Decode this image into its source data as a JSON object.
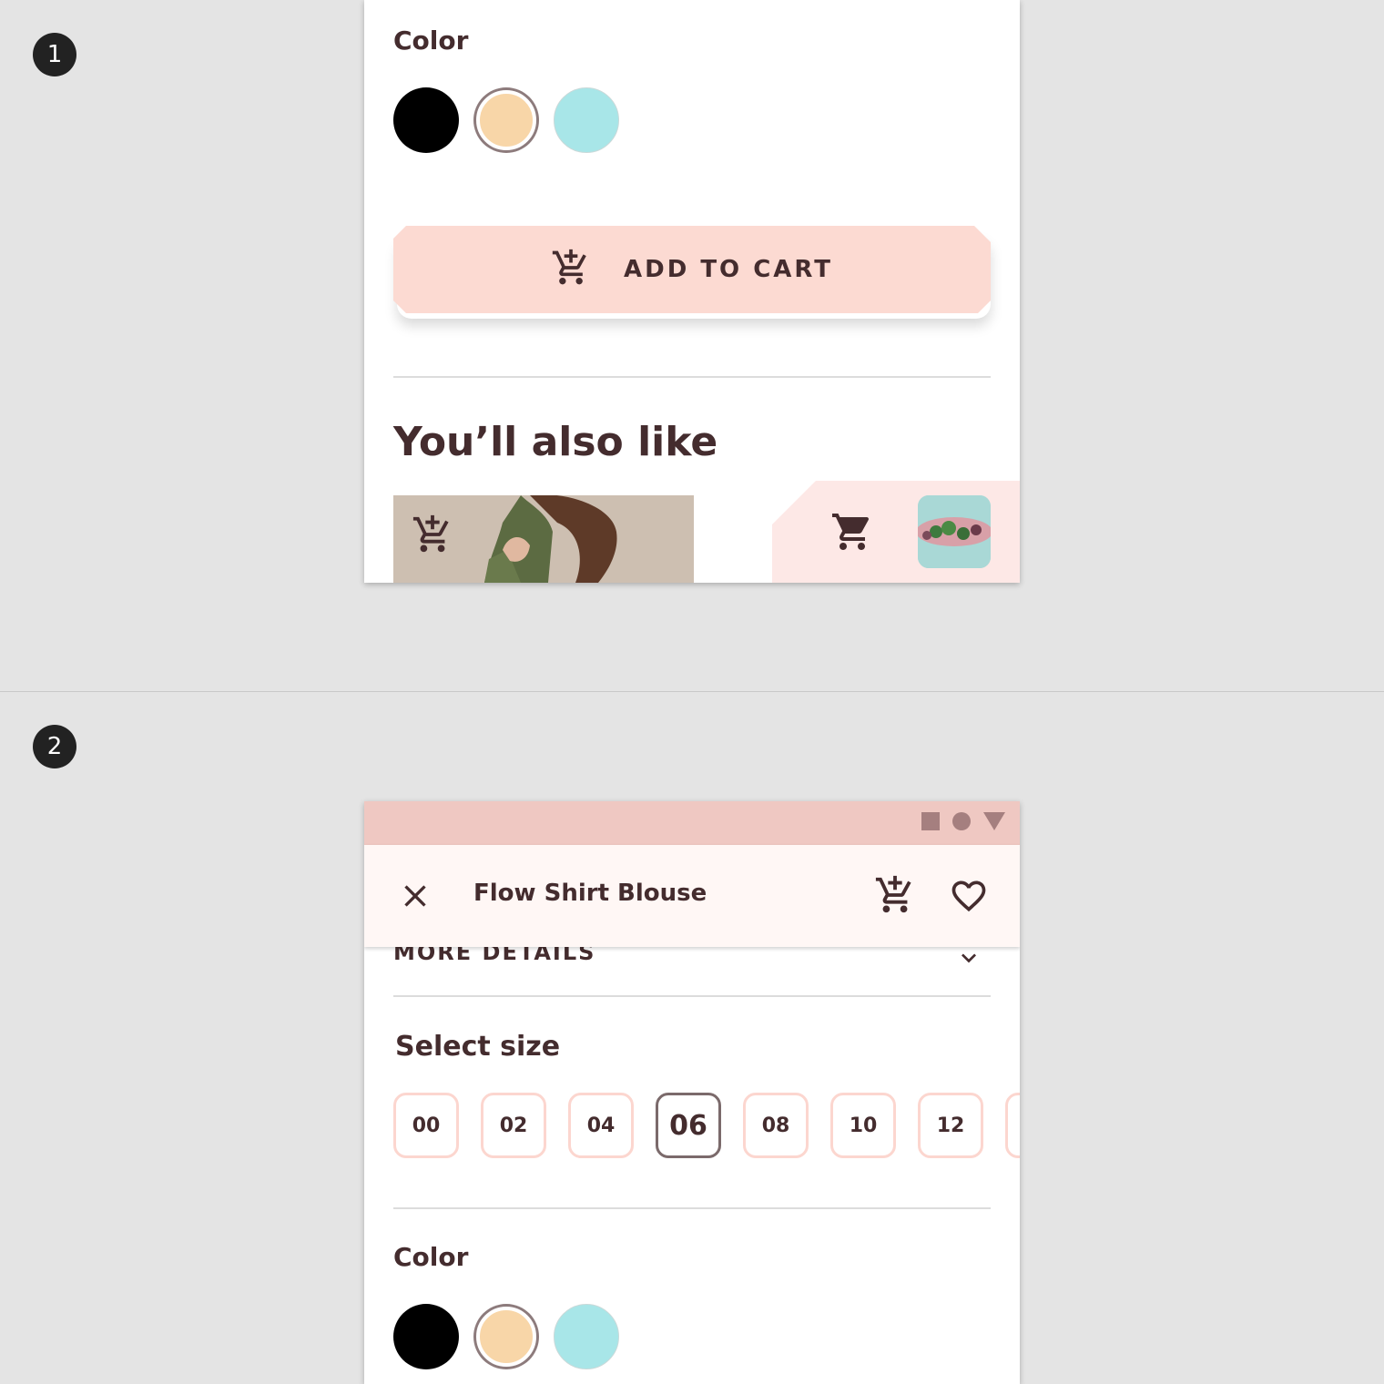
{
  "steps": [
    "1",
    "2"
  ],
  "screen1": {
    "color_label": "Color",
    "colors": [
      "#000000",
      "#f8d6a8",
      "#a8e6e8"
    ],
    "selected_color_index": 1,
    "add_to_cart_label": "ADD TO CART",
    "also_like_title": "You’ll also like"
  },
  "screen2": {
    "status_icons": [
      "square-icon",
      "circle-icon",
      "triangle-icon"
    ],
    "app_bar": {
      "title": "Flow Shirt Blouse",
      "close_icon": "close-icon",
      "cart_icon": "add-shopping-cart-icon",
      "favorite_icon": "heart-outline-icon"
    },
    "more_details_label": "MORE DETAILS",
    "select_size_label": "Select size",
    "sizes": [
      "00",
      "02",
      "04",
      "06",
      "08",
      "10",
      "12"
    ],
    "selected_size": "06",
    "color_label": "Color",
    "colors": [
      "#000000",
      "#f8d6a8",
      "#a8e6e8"
    ],
    "selected_color_index": 1
  },
  "accent_colors": {
    "primary": "#fcdad2",
    "status_bar": "#efc8c2",
    "text": "#442c2e",
    "tray": "#fde8e6"
  }
}
